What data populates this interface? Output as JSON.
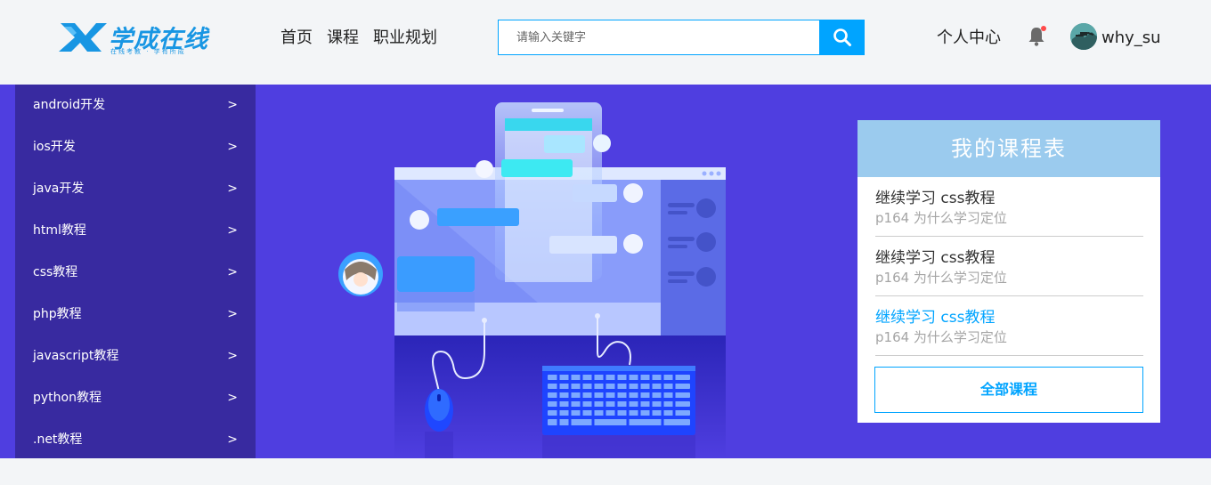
{
  "header": {
    "logo": {
      "text": "学成在线",
      "tagline": "在线考教 · 学有所成"
    },
    "nav": [
      {
        "label": "首页"
      },
      {
        "label": "课程"
      },
      {
        "label": "职业规划"
      }
    ],
    "search": {
      "placeholder": "请输入关键字",
      "value": "",
      "icon": "search-icon"
    },
    "user_center": "个人中心",
    "notification": {
      "icon": "bell-icon",
      "has_unread": true
    },
    "user": {
      "name": "why_su",
      "avatar": "avatar-image"
    }
  },
  "sidebar": {
    "items": [
      {
        "label": "android开发",
        "arrow": ">"
      },
      {
        "label": "ios开发",
        "arrow": ">"
      },
      {
        "label": "java开发",
        "arrow": ">"
      },
      {
        "label": "html教程",
        "arrow": ">"
      },
      {
        "label": "css教程",
        "arrow": ">"
      },
      {
        "label": "php教程",
        "arrow": ">"
      },
      {
        "label": "javascript教程",
        "arrow": ">"
      },
      {
        "label": "python教程",
        "arrow": ">"
      },
      {
        "label": ".net教程",
        "arrow": ">"
      }
    ]
  },
  "course_table": {
    "title": "我的课程表",
    "items": [
      {
        "title": "继续学习 css教程",
        "subtitle": "p164 为什么学习定位",
        "active": false
      },
      {
        "title": "继续学习 css教程",
        "subtitle": "p164 为什么学习定位",
        "active": false
      },
      {
        "title": "继续学习 css教程",
        "subtitle": "p164 为什么学习定位",
        "active": true
      }
    ],
    "all_button": "全部课程"
  },
  "colors": {
    "accent": "#00a4ff",
    "banner_bg": "#4f3ee0",
    "sidebar_bg": "#382aa0",
    "course_head_bg": "#9bcbee",
    "logo": "#1896e3"
  }
}
